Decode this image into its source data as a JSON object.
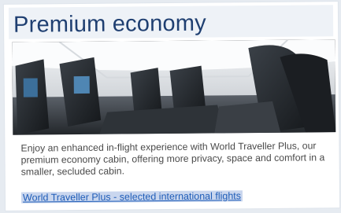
{
  "panel": {
    "title": "Premium economy",
    "image_alt_icon": "cabin-photo",
    "description": "Enjoy an enhanced in-flight experience with World Traveller Plus, our premium economy cabin, offering more privacy, space and comfort in a smaller, secluded cabin.",
    "link_text": "World Traveller Plus - selected international flights"
  },
  "colors": {
    "title": "#1f3f71",
    "link": "#1f5db8",
    "link_highlight": "#c9d6ee",
    "text": "#4a4a4a"
  }
}
